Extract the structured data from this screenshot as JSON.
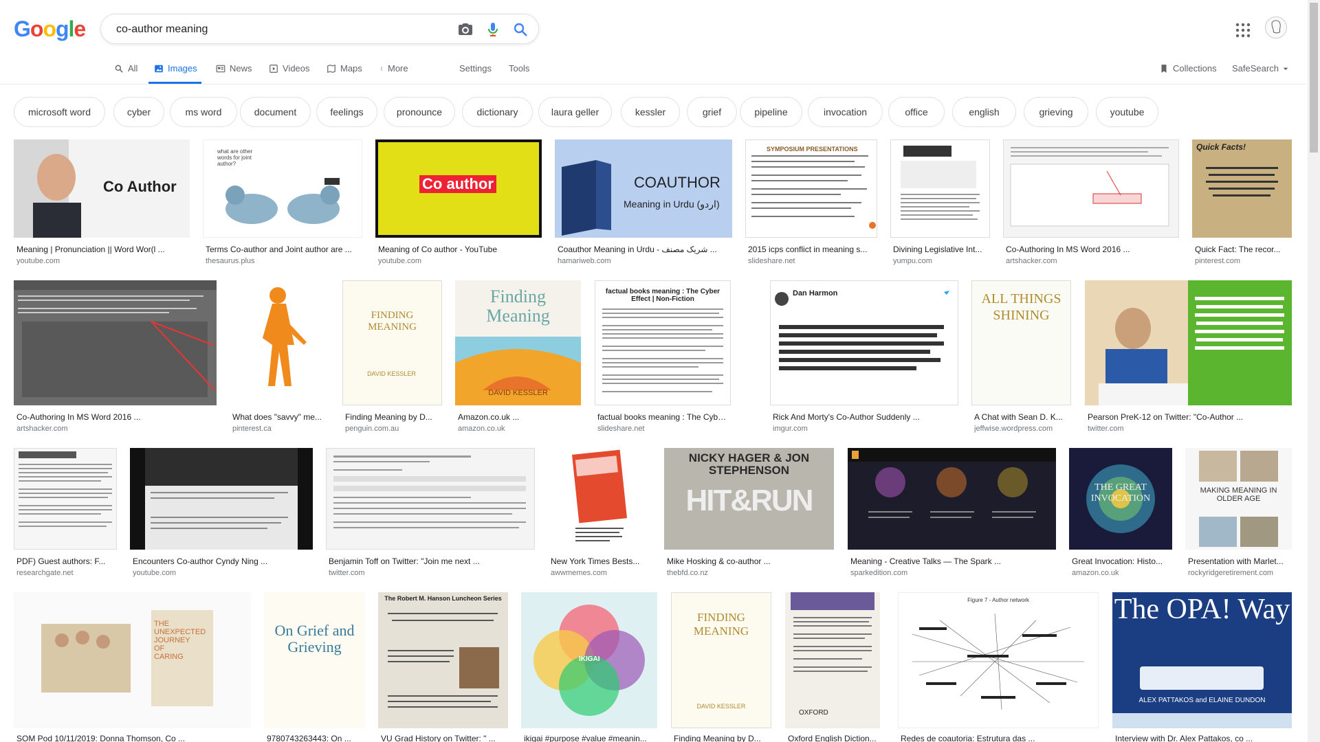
{
  "logo": {
    "letters": [
      "G",
      "o",
      "o",
      "g",
      "l",
      "e"
    ],
    "colors": [
      "#4285F4",
      "#EA4335",
      "#FBBC05",
      "#4285F4",
      "#34A853",
      "#EA4335"
    ]
  },
  "search": {
    "query": "co-author meaning"
  },
  "tabs": [
    {
      "label": "All",
      "icon": "search-icon"
    },
    {
      "label": "Images",
      "icon": "image-icon",
      "active": true
    },
    {
      "label": "News",
      "icon": "news-icon"
    },
    {
      "label": "Videos",
      "icon": "video-icon"
    },
    {
      "label": "Maps",
      "icon": "map-icon"
    },
    {
      "label": "More",
      "icon": "more-vert-icon"
    },
    {
      "label": "Settings"
    },
    {
      "label": "Tools"
    }
  ],
  "right": {
    "collections": "Collections",
    "safesearch": "SafeSearch"
  },
  "chips": [
    "microsoft word",
    "cyber",
    "ms word",
    "document",
    "feelings",
    "pronounce",
    "dictionary",
    "laura geller",
    "kessler",
    "grief",
    "pipeline",
    "invocation",
    "office",
    "english",
    "grieving",
    "youtube"
  ],
  "results": [
    {
      "caption": "Meaning | Pronunciation || Word Wor(l ...",
      "domain": "youtube.com",
      "thumb_text": "Co Author"
    },
    {
      "caption": "Terms Co-author and Joint author are ...",
      "domain": "thesaurus.plus",
      "thumb_text": "what are other words for joint author?"
    },
    {
      "caption": "Meaning of Co author - YouTube",
      "domain": "youtube.com",
      "thumb_text": "Co author"
    },
    {
      "caption": "Coauthor Meaning in Urdu - شریک مصنف ...",
      "domain": "hamariweb.com",
      "thumb_text": "COAUTHOR",
      "thumb_text2": "Meaning in Urdu (اردو)"
    },
    {
      "caption": "2015 icps conflict in meaning s...",
      "domain": "slideshare.net",
      "thumb_text": "SYMPOSIUM PRESENTATIONS"
    },
    {
      "caption": "Divining Legislative Int...",
      "domain": "yumpu.com"
    },
    {
      "caption": "Co-Authoring In MS Word 2016 ...",
      "domain": "artshacker.com"
    },
    {
      "caption": "Quick Fact: The recor...",
      "domain": "pinterest.com",
      "thumb_text": "Quick Facts!"
    },
    {
      "caption": "Co-Authoring In MS Word 2016 ...",
      "domain": "artshacker.com"
    },
    {
      "caption": "What does \"savvy\" me...",
      "domain": "pinterest.ca"
    },
    {
      "caption": "Finding Meaning by D...",
      "domain": "penguin.com.au",
      "thumb_text": "FINDING MEANING",
      "thumb_text2": "DAVID KESSLER"
    },
    {
      "caption": "Amazon.co.uk ...",
      "domain": "amazon.co.uk",
      "thumb_text": "Finding Meaning",
      "thumb_text2": "DAVID KESSLER"
    },
    {
      "caption": "factual books meaning : The Cyber ...",
      "domain": "slideshare.net",
      "thumb_text": "factual books meaning : The Cyber Effect | Non-Fiction"
    },
    {
      "caption": "Rick And Morty's Co-Author Suddenly ...",
      "domain": "imgur.com",
      "thumb_text": "Dan Harmon"
    },
    {
      "caption": "A Chat with Sean D. K...",
      "domain": "jeffwise.wordpress.com",
      "thumb_text": "ALL THINGS SHINING"
    },
    {
      "caption": "Pearson PreK-12 on Twitter: \"Co-Author ...",
      "domain": "twitter.com"
    },
    {
      "caption": "PDF) Guest authors: F...",
      "domain": "researchgate.net"
    },
    {
      "caption": "Encounters Co-author Cyndy Ning ...",
      "domain": "youtube.com"
    },
    {
      "caption": "Benjamin Toff on Twitter: \"Join me next ...",
      "domain": "twitter.com"
    },
    {
      "caption": "New York Times Bests...",
      "domain": "awwmemes.com"
    },
    {
      "caption": "Mike Hosking & co-author ...",
      "domain": "thebfd.co.nz",
      "thumb_text": "NICKY HAGER & JON STEPHENSON",
      "thumb_text2": "HIT&RUN"
    },
    {
      "caption": "Meaning - Creative Talks — The Spark ...",
      "domain": "sparkedition.com"
    },
    {
      "caption": "Great Invocation: Histo...",
      "domain": "amazon.co.uk",
      "thumb_text": "THE GREAT INVOCATION"
    },
    {
      "caption": "Presentation with Marlet...",
      "domain": "rockyridgeretirement.com",
      "thumb_text": "MAKING MEANING IN OLDER AGE"
    },
    {
      "caption": "SOM Pod 10/11/2019: Donna Thomson, Co ...",
      "domain": "",
      "thumb_text": "THE UNEXPECTED JOURNEY OF CARING"
    },
    {
      "caption": "9780743263443: On ...",
      "domain": "",
      "thumb_text": "On Grief and Grieving"
    },
    {
      "caption": "VU Grad History on Twitter: \" ...",
      "domain": "",
      "thumb_text": "The Robert M. Hanson Luncheon Series"
    },
    {
      "caption": "ikigai #purpose #value #meanin...",
      "domain": "",
      "thumb_text": "IKIGAI"
    },
    {
      "caption": "Finding Meaning by D...",
      "domain": "",
      "thumb_text": "FINDING MEANING",
      "thumb_text2": "DAVID KESSLER"
    },
    {
      "caption": "Oxford English Diction...",
      "domain": "",
      "thumb_text": "OXFORD"
    },
    {
      "caption": "Redes de coautoria: Estrutura das ...",
      "domain": "",
      "thumb_text": "Figure 7 - Author network"
    },
    {
      "caption": "Interview with Dr. Alex Pattakos, co ...",
      "domain": "",
      "thumb_text": "The OPA! Way",
      "thumb_text2": "ALEX PATTAKOS and ELAINE DUNDON"
    }
  ]
}
